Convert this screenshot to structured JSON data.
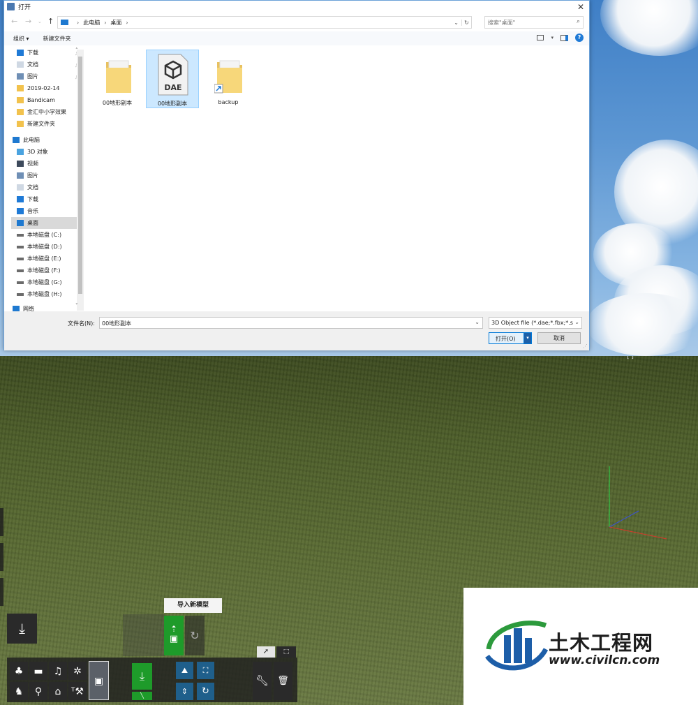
{
  "dialog": {
    "title": "打开",
    "close_glyph": "✕",
    "address": {
      "crumbs": [
        "此电脑",
        "桌面"
      ],
      "search_placeholder": "搜索\"桌面\""
    },
    "toolbar": {
      "organize": "组织 ▾",
      "new_folder": "新建文件夹"
    },
    "nav": {
      "quick_access": [
        {
          "label": "下载",
          "icon": "download-icon"
        },
        {
          "label": "文档",
          "icon": "document-icon"
        },
        {
          "label": "图片",
          "icon": "picture-icon"
        },
        {
          "label": "2019-02-14",
          "icon": "folder-icon"
        },
        {
          "label": "Bandicam",
          "icon": "folder-icon"
        },
        {
          "label": "金汇中小学效果",
          "icon": "folder-icon"
        },
        {
          "label": "新建文件夹",
          "icon": "folder-icon"
        }
      ],
      "this_pc": "此电脑",
      "pc_items": [
        {
          "label": "3D 对象",
          "icon": "cube-icon"
        },
        {
          "label": "视频",
          "icon": "video-icon"
        },
        {
          "label": "图片",
          "icon": "picture-icon"
        },
        {
          "label": "文档",
          "icon": "document-icon"
        },
        {
          "label": "下载",
          "icon": "download-icon"
        },
        {
          "label": "音乐",
          "icon": "music-icon"
        },
        {
          "label": "桌面",
          "icon": "desktop-icon",
          "selected": true
        },
        {
          "label": "本地磁盘 (C:)",
          "icon": "drive-icon"
        },
        {
          "label": "本地磁盘 (D:)",
          "icon": "drive-icon"
        },
        {
          "label": "本地磁盘 (E:)",
          "icon": "drive-icon"
        },
        {
          "label": "本地磁盘 (F:)",
          "icon": "drive-icon"
        },
        {
          "label": "本地磁盘 (G:)",
          "icon": "drive-icon"
        },
        {
          "label": "本地磁盘 (H:)",
          "icon": "drive-icon"
        }
      ],
      "network": "网络"
    },
    "files": [
      {
        "name": "00地形副本",
        "type": "folder"
      },
      {
        "name": "00地形副本",
        "type": "dae",
        "badge": "DAE",
        "selected": true
      },
      {
        "name": "backup",
        "type": "shortcut-folder"
      }
    ],
    "bottom": {
      "filename_label": "文件名(N):",
      "filename_value": "00地形副本",
      "filter": "3D Object file (*.dae;*.fbx;*.s",
      "open": "打开(O)",
      "cancel": "取消"
    }
  },
  "game": {
    "tooltip": "导入新模型"
  },
  "watermark": {
    "title": "土木工程网",
    "url": "www.civilcn.com",
    "colors": {
      "blue": "#1d5ea8",
      "green": "#2c9a3c"
    }
  },
  "colors": {
    "accent": "#0078d7",
    "selection": "#cce8ff",
    "game_green": "#1e9b2a",
    "game_blue": "#1f5f8b"
  }
}
